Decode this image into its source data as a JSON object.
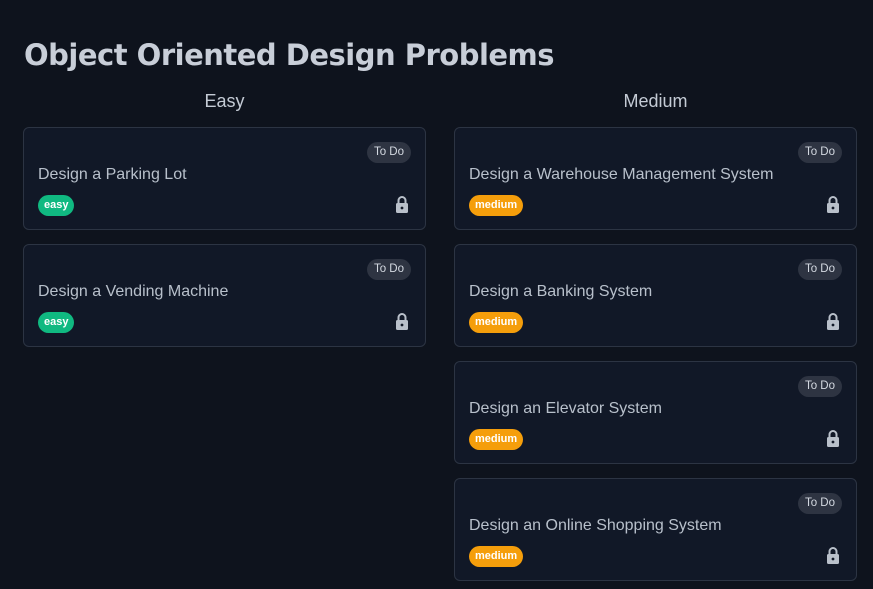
{
  "page": {
    "title": "Object Oriented Design Problems"
  },
  "columns": [
    {
      "heading": "Easy",
      "cards": [
        {
          "title": "Design a Parking Lot",
          "status": "To Do",
          "difficulty": "easy"
        },
        {
          "title": "Design a Vending Machine",
          "status": "To Do",
          "difficulty": "easy"
        }
      ]
    },
    {
      "heading": "Medium",
      "cards": [
        {
          "title": "Design a Warehouse Management System",
          "status": "To Do",
          "difficulty": "medium"
        },
        {
          "title": "Design a Banking System",
          "status": "To Do",
          "difficulty": "medium"
        },
        {
          "title": "Design an Elevator System",
          "status": "To Do",
          "difficulty": "medium"
        },
        {
          "title": "Design an Online Shopping System",
          "status": "To Do",
          "difficulty": "medium"
        }
      ]
    }
  ],
  "icons": {
    "locked": "lock-icon"
  },
  "colors": {
    "background": "#0e131d",
    "card_background": "#111827",
    "card_border": "#2c3443",
    "easy": "#10b981",
    "medium": "#f59e0b",
    "status_pill": "#2e3442"
  }
}
